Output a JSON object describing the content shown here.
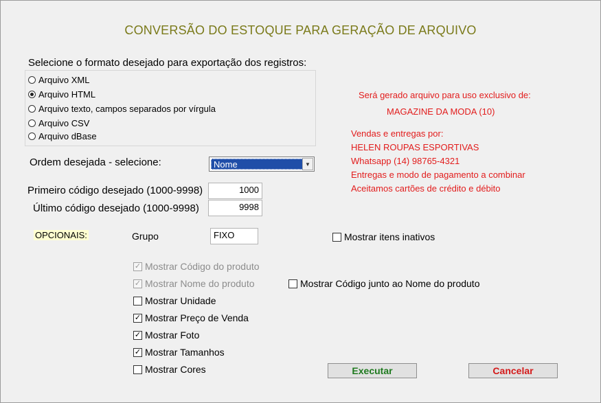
{
  "title": "CONVERSÃO DO ESTOQUE PARA GERAÇÃO DE ARQUIVO",
  "format": {
    "label": "Selecione o formato desejado para exportação dos registros:",
    "options": [
      "Arquivo XML",
      "Arquivo HTML",
      "Arquivo texto, campos separados por vírgula",
      "Arquivo CSV",
      "Arquivo dBase"
    ],
    "selected": "Arquivo HTML"
  },
  "ordem": {
    "label": "Ordem desejada - selecione:",
    "value": "Nome"
  },
  "codigos": {
    "first_label": "Primeiro código desejado  (1000-9998)",
    "first_value": "1000",
    "last_label": "Último  código  desejado (1000-9998)",
    "last_value": "9998"
  },
  "info": {
    "exclusive": "Será gerado arquivo para uso exclusivo de:",
    "company": "MAGAZINE DA MODA   (10)",
    "lines": [
      "Vendas e entregas por:",
      "HELEN ROUPAS ESPORTIVAS",
      "Whatsapp (14) 98765-4321",
      "Entregas e modo de pagamento a combinar",
      "Aceitamos cartões de crédito e débito"
    ]
  },
  "opcionais": {
    "label": "OPCIONAIS:",
    "grupo_label": "Grupo",
    "grupo_value": "FIXO",
    "inativos": {
      "label": "Mostrar itens inativos",
      "checked": false
    },
    "codigo_junto": {
      "label": "Mostrar Código junto ao Nome do produto",
      "checked": false
    },
    "items": [
      {
        "label": "Mostrar Código do produto",
        "checked": true,
        "disabled": true
      },
      {
        "label": "Mostrar Nome do produto",
        "checked": true,
        "disabled": true
      },
      {
        "label": "Mostrar Unidade",
        "checked": false,
        "disabled": false
      },
      {
        "label": "Mostrar Preço de Venda",
        "checked": true,
        "disabled": false
      },
      {
        "label": "Mostrar Foto",
        "checked": true,
        "disabled": false
      },
      {
        "label": "Mostrar Tamanhos",
        "checked": true,
        "disabled": false
      },
      {
        "label": "Mostrar Cores",
        "checked": false,
        "disabled": false
      }
    ]
  },
  "buttons": {
    "execute": "Executar",
    "cancel": "Cancelar",
    "execute_color": "#1f7a1f",
    "cancel_color": "#d41a1a"
  },
  "colors": {
    "title": "#7a7a1a",
    "info_red": "#e21c1c",
    "selection": "#1f4ea8"
  }
}
